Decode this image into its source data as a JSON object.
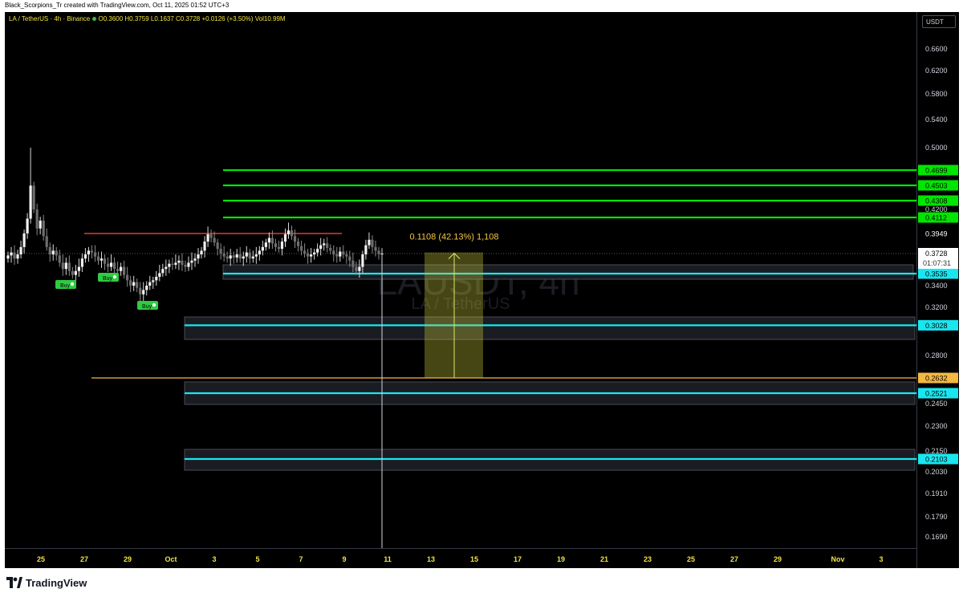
{
  "attribution": "Black_Scorpions_Tr created with TradingView.com, Oct 11, 2025 01:52 UTC+3",
  "legend": {
    "symbol": "LA / TetherUS · 4h · Binance",
    "ohlc": "O0.3600 H0.3759 L0.1637 C0.3728 +0.0126 (+3.50%)",
    "volume": "Vol10.99M"
  },
  "currency": "USDT",
  "watermark": {
    "symbol": "LAUSDT, 4h",
    "name": "LA / TetherUS"
  },
  "footer": {
    "brand": "TradingView"
  },
  "measure_label": "0.1108 (42.13%) 1,108",
  "colors": {
    "green": "#00e600",
    "cyan": "#1ae6f0",
    "red": "#e53935",
    "orange": "#f5b942",
    "measure": "#c9c93a"
  },
  "chart_data": {
    "type": "candlestick",
    "symbol": "LAUSDT",
    "interval": "4h",
    "exchange": "Binance",
    "y_ticks": [
      0.66,
      0.62,
      0.58,
      0.54,
      0.5,
      0.42,
      0.34,
      0.32,
      0.3,
      0.28,
      0.245,
      0.23,
      0.215,
      0.203,
      0.191,
      0.179,
      0.169
    ],
    "y_tick_labels": [
      "0.6600",
      "0.6200",
      "0.5800",
      "0.5400",
      "0.5000",
      "0.4200",
      "0.3400",
      "0.3200",
      "0.3000",
      "0.2800",
      "0.2450",
      "0.2300",
      "0.2150",
      "0.2030",
      "0.1910",
      "0.1790",
      "0.1690"
    ],
    "x_ticks": [
      "25",
      "27",
      "29",
      "Oct",
      "3",
      "5",
      "7",
      "9",
      "11",
      "13",
      "15",
      "17",
      "19",
      "21",
      "23",
      "25",
      "27",
      "29",
      "Nov",
      "3"
    ],
    "current_price": {
      "value": "0.3728",
      "countdown": "01:07:31"
    },
    "price_labels": [
      {
        "value": "0.3949",
        "color": "plain"
      }
    ],
    "resistance_levels": [
      {
        "value": "0.4699",
        "color": "green"
      },
      {
        "value": "0.4503",
        "color": "green"
      },
      {
        "value": "0.4308",
        "color": "green"
      },
      {
        "value": "0.4112",
        "color": "green"
      }
    ],
    "support_levels": [
      {
        "value": "0.3535",
        "color": "cyan"
      },
      {
        "value": "0.3028",
        "color": "cyan"
      },
      {
        "value": "0.2632",
        "color": "orange"
      },
      {
        "value": "0.2521",
        "color": "cyan"
      },
      {
        "value": "0.2103",
        "color": "cyan"
      }
    ],
    "range_line": {
      "value": 0.3949,
      "color": "red"
    },
    "measurement": {
      "from": 0.2632,
      "to": 0.374,
      "change": "0.1108",
      "percent": "42.13%",
      "bars": "1,108"
    },
    "signals": [
      {
        "label": "Buy",
        "time": "Sep 26"
      },
      {
        "label": "Buy",
        "time": "Sep 28"
      },
      {
        "label": "Buy",
        "time": "Sep 30"
      }
    ],
    "closes": [
      0.371,
      0.374,
      0.368,
      0.372,
      0.38,
      0.395,
      0.41,
      0.45,
      0.42,
      0.4,
      0.408,
      0.392,
      0.38,
      0.372,
      0.376,
      0.371,
      0.364,
      0.358,
      0.364,
      0.356,
      0.352,
      0.356,
      0.36,
      0.368,
      0.372,
      0.376,
      0.374,
      0.37,
      0.366,
      0.368,
      0.363,
      0.36,
      0.364,
      0.358,
      0.356,
      0.36,
      0.352,
      0.346,
      0.34,
      0.344,
      0.338,
      0.332,
      0.336,
      0.34,
      0.344,
      0.346,
      0.35,
      0.354,
      0.358,
      0.36,
      0.363,
      0.362,
      0.364,
      0.366,
      0.362,
      0.36,
      0.364,
      0.366,
      0.368,
      0.372,
      0.376,
      0.386,
      0.394,
      0.39,
      0.385,
      0.378,
      0.373,
      0.37,
      0.368,
      0.371,
      0.369,
      0.372,
      0.368,
      0.37,
      0.374,
      0.368,
      0.37,
      0.372,
      0.376,
      0.38,
      0.385,
      0.39,
      0.384,
      0.38,
      0.378,
      0.386,
      0.394,
      0.398,
      0.392,
      0.386,
      0.381,
      0.376,
      0.373,
      0.37,
      0.372,
      0.374,
      0.378,
      0.382,
      0.384,
      0.379,
      0.376,
      0.372,
      0.37,
      0.375,
      0.372,
      0.37,
      0.366,
      0.36,
      0.356,
      0.36,
      0.372,
      0.382,
      0.388,
      0.38,
      0.376,
      0.372,
      0.3728
    ]
  }
}
